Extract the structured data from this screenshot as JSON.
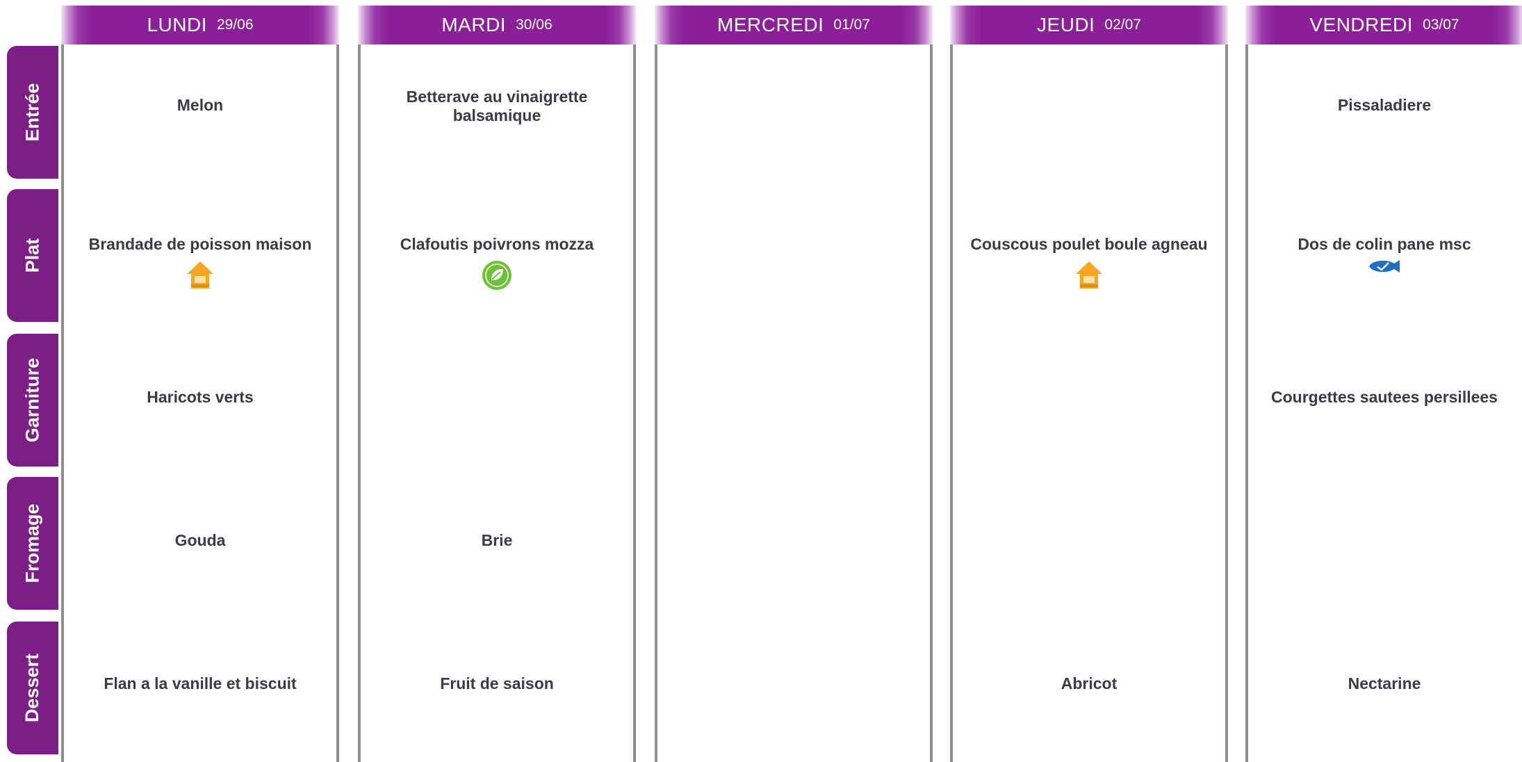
{
  "rows": [
    {
      "label": "Entrée"
    },
    {
      "label": "Plat"
    },
    {
      "label": "Garniture"
    },
    {
      "label": "Fromage"
    },
    {
      "label": "Dessert"
    }
  ],
  "days": [
    {
      "name": "LUNDI",
      "date": "29/06",
      "entree": "Melon",
      "plat": "Brandade de poisson maison",
      "plat_icon": "house-homemade-icon",
      "garniture": "Haricots verts",
      "fromage": "Gouda",
      "dessert": "Flan a la vanille et biscuit"
    },
    {
      "name": "MARDI",
      "date": "30/06",
      "entree": "Betterave au vinaigrette balsamique",
      "plat": "Clafoutis poivrons mozza",
      "plat_icon": "vegetarian-leaf-icon",
      "garniture": "",
      "fromage": "Brie",
      "dessert": "Fruit de saison"
    },
    {
      "name": "MERCREDI",
      "date": "01/07",
      "entree": "",
      "plat": "",
      "garniture": "",
      "fromage": "",
      "dessert": ""
    },
    {
      "name": "JEUDI",
      "date": "02/07",
      "entree": "",
      "plat": "Couscous poulet boule agneau",
      "plat_icon": "house-homemade-icon",
      "garniture": "",
      "fromage": "",
      "dessert": "Abricot"
    },
    {
      "name": "VENDREDI",
      "date": "03/07",
      "entree": "Pissaladiere",
      "plat": "Dos de colin pane msc",
      "plat_icon": "msc-fish-label-icon",
      "garniture": "Courgettes sautees persillees",
      "fromage": "",
      "dessert": "Nectarine"
    }
  ],
  "colors": {
    "header_purple": "#8b1f98",
    "tab_purple": "#7b1e86",
    "dish_text": "#3c3a46",
    "divider_grey": "#8e8e8e",
    "homemade_orange": "#f5a623",
    "vegetarian_green": "#6fbf3b",
    "msc_blue": "#1f6fc5"
  }
}
